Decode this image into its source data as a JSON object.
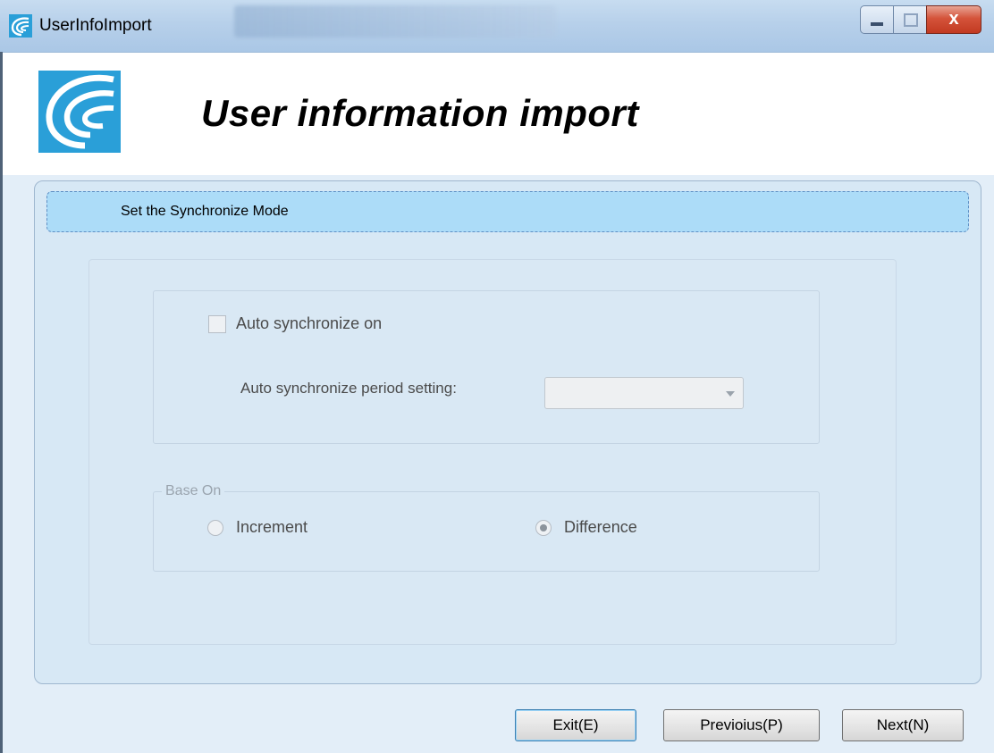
{
  "window": {
    "title": "UserInfoImport",
    "controls": {
      "minimize": "minimize",
      "maximize": "maximize",
      "close": "x"
    }
  },
  "header": {
    "title": "User information import"
  },
  "step": {
    "label": "Set the Synchronize  Mode"
  },
  "sync": {
    "auto_label": "Auto synchronize on",
    "auto_checked": false,
    "period_label": "Auto synchronize period setting:",
    "period_value": ""
  },
  "base_on": {
    "legend": "Base On",
    "options": [
      {
        "label": "Increment",
        "selected": false
      },
      {
        "label": "Difference",
        "selected": true
      }
    ]
  },
  "buttons": {
    "exit": "Exit(E)",
    "previous": "Previoius(P)",
    "next": "Next(N)"
  },
  "colors": {
    "banner": "#acdcf8",
    "panel": "#d7e8f5",
    "logo_blue": "#2a9fd8"
  }
}
